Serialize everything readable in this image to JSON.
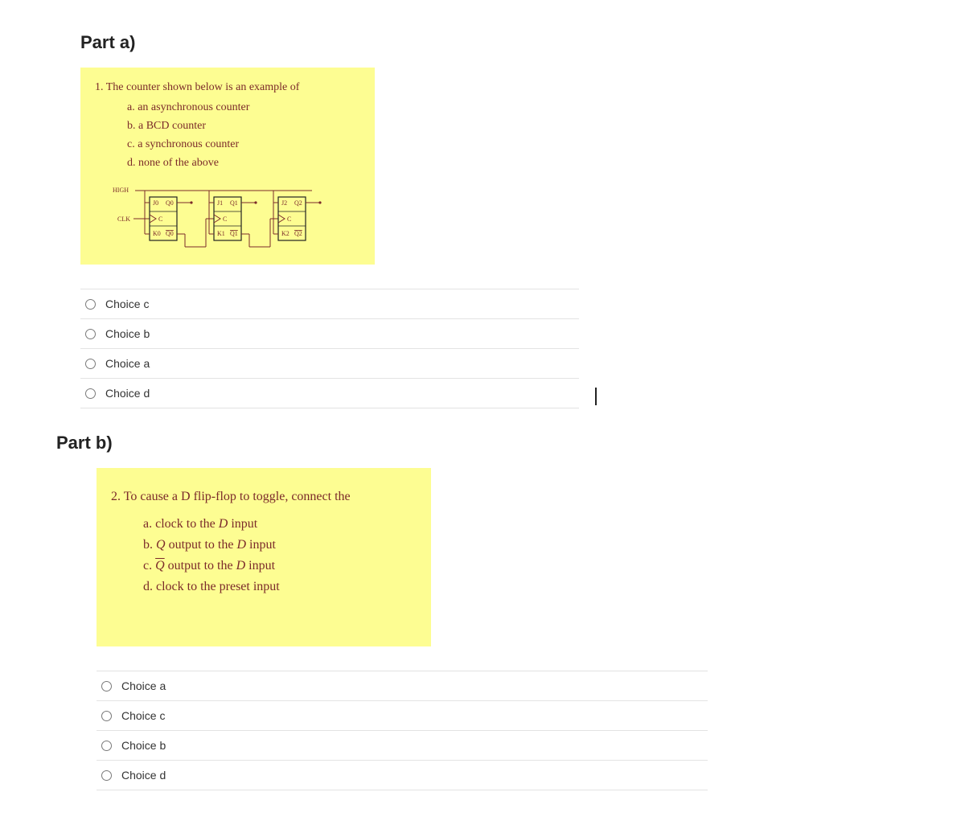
{
  "part_a": {
    "heading": "Part a)",
    "question_number": "1.",
    "question_text": "The counter shown below is an example  of",
    "options": {
      "a": "a.  an asynchronous  counter",
      "b": "b.  a BCD counter",
      "c": "c.  a synchronous  counter",
      "d": "d.  none of the above"
    },
    "circuit": {
      "high_label": "HIGH",
      "clk_label": "CLK",
      "ff": [
        {
          "J": "J0",
          "K": "K0",
          "C": "C",
          "Q": "Q0",
          "Qb": "Q0"
        },
        {
          "J": "J1",
          "K": "K1",
          "C": "C",
          "Q": "Q1",
          "Qb": "Q1"
        },
        {
          "J": "J2",
          "K": "K2",
          "C": "C",
          "Q": "Q2",
          "Qb": "Q2"
        }
      ]
    },
    "choices": [
      "Choice c",
      "Choice b",
      "Choice a",
      "Choice d"
    ]
  },
  "part_b": {
    "heading": "Part b)",
    "question_number": "2.",
    "question_text": "To cause  a D flip-flop  to toggle,  connect the",
    "options": {
      "a_pre": "a. clock to the ",
      "a_post": " input",
      "b_pre": "b. ",
      "b_mid": " output to the ",
      "b_post": " input",
      "c_pre": "c. ",
      "c_mid": " output to the ",
      "c_post": " input",
      "d": "d. clock to the preset input",
      "D": "D",
      "Q": "Q",
      "Qbar": "Q"
    },
    "choices": [
      "Choice a",
      "Choice c",
      "Choice b",
      "Choice d"
    ]
  }
}
